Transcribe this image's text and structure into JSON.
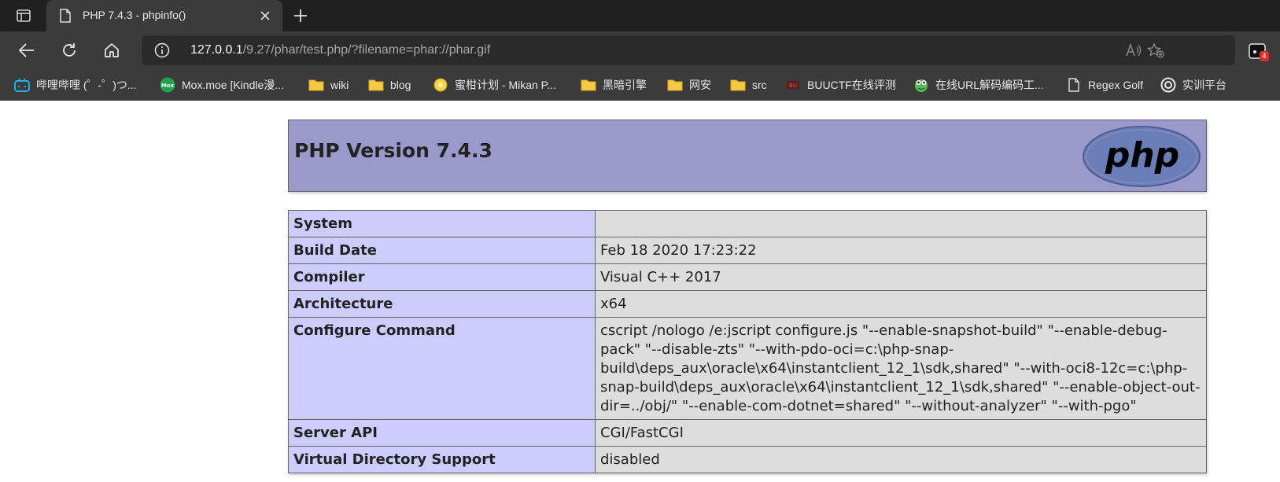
{
  "browser": {
    "tab": {
      "title": "PHP 7.4.3 - phpinfo()"
    },
    "address": {
      "host": "127.0.0.1",
      "path": "/9.27/phar/test.php/?filename=phar://phar.gif"
    },
    "extensions": {
      "badge_count": "4"
    },
    "bookmarks": [
      {
        "label": "哔哩哔哩 (゜-゜)つ...",
        "icon": "bilibili-icon"
      },
      {
        "label": "Mox.moe [Kindle漫...",
        "icon": "mox-icon"
      },
      {
        "label": "wiki",
        "icon": "folder-icon"
      },
      {
        "label": "blog",
        "icon": "folder-icon"
      },
      {
        "label": "蜜柑计划 - Mikan P...",
        "icon": "mikan-icon"
      },
      {
        "label": "黑暗引擎",
        "icon": "folder-icon"
      },
      {
        "label": "网安",
        "icon": "folder-icon"
      },
      {
        "label": "src",
        "icon": "folder-icon"
      },
      {
        "label": "BUUCTF在线评测",
        "icon": "buuctf-icon"
      },
      {
        "label": "在线URL解码编码工...",
        "icon": "frog-icon"
      },
      {
        "label": "Regex Golf",
        "icon": "page-icon"
      },
      {
        "label": "实训平台",
        "icon": "platform-icon"
      }
    ]
  },
  "phpinfo": {
    "version_title": "PHP Version 7.4.3",
    "rows": [
      {
        "key": "System",
        "value": ""
      },
      {
        "key": "Build Date",
        "value": "Feb 18 2020 17:23:22"
      },
      {
        "key": "Compiler",
        "value": "Visual C++ 2017"
      },
      {
        "key": "Architecture",
        "value": "x64"
      },
      {
        "key": "Configure Command",
        "value": "cscript /nologo /e:jscript configure.js \"--enable-snapshot-build\" \"--enable-debug-pack\" \"--disable-zts\" \"--with-pdo-oci=c:\\php-snap-build\\deps_aux\\oracle\\x64\\instantclient_12_1\\sdk,shared\" \"--with-oci8-12c=c:\\php-snap-build\\deps_aux\\oracle\\x64\\instantclient_12_1\\sdk,shared\" \"--enable-object-out-dir=../obj/\" \"--enable-com-dotnet=shared\" \"--without-analyzer\" \"--with-pgo\""
      },
      {
        "key": "Server API",
        "value": "CGI/FastCGI"
      },
      {
        "key": "Virtual Directory Support",
        "value": "disabled"
      }
    ]
  },
  "colors": {
    "header_bg": "#9999cc",
    "key_bg": "#ccccff",
    "value_bg": "#dddddd",
    "chrome_dark": "#202020",
    "chrome_mid": "#3b3b3b"
  }
}
